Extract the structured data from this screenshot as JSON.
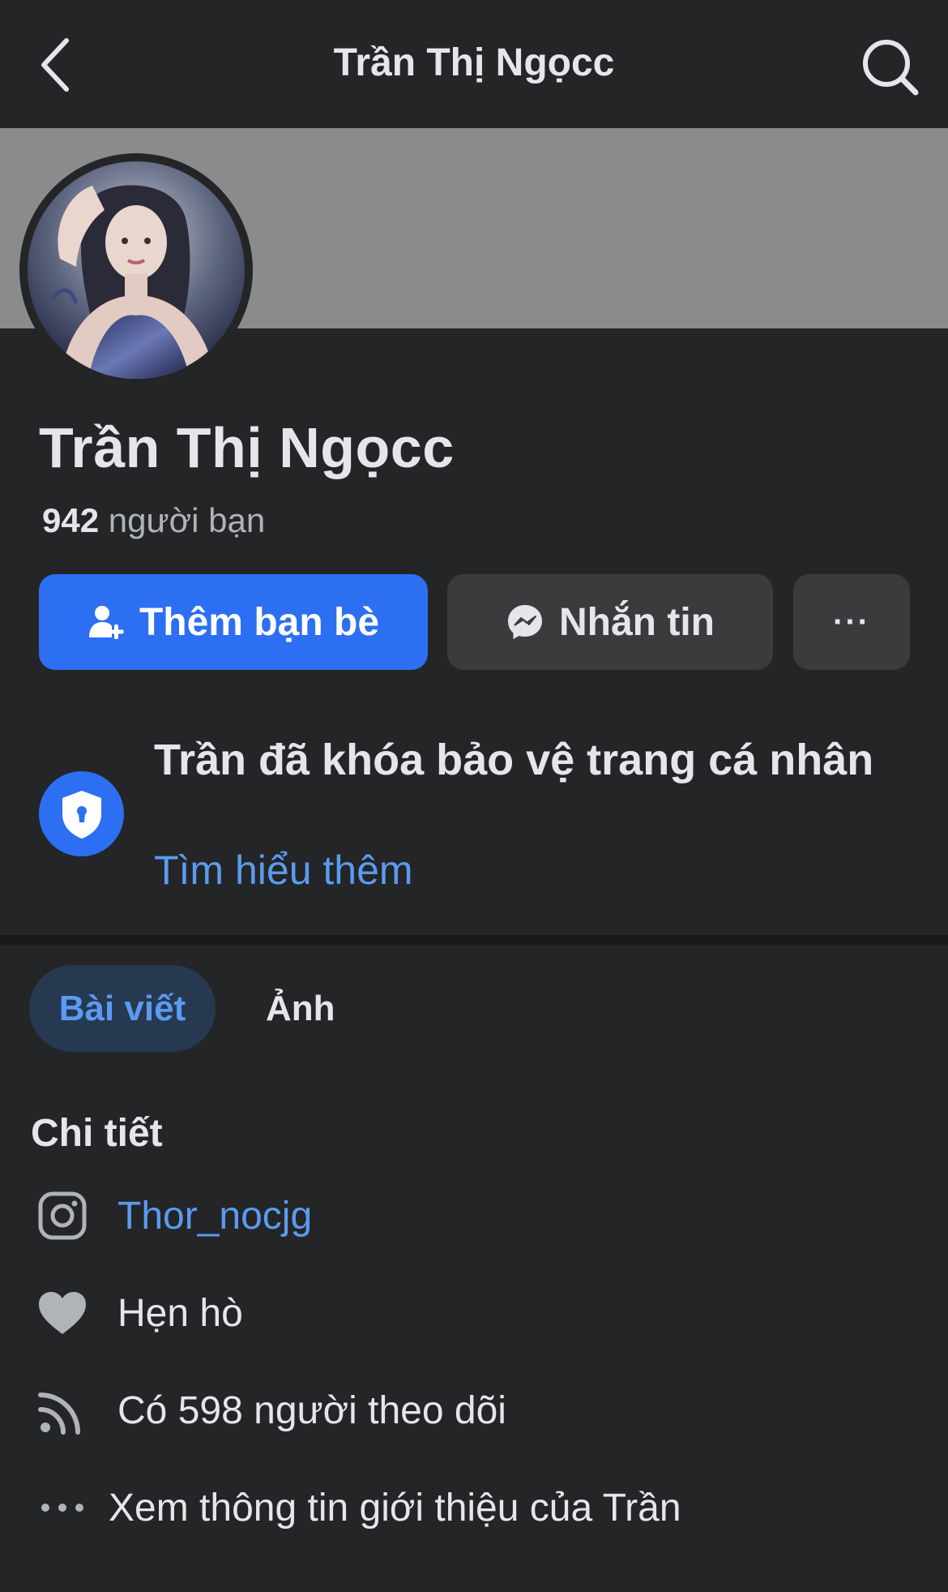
{
  "header": {
    "title": "Trần Thị Ngọcc",
    "back_icon": "chevron-left-icon",
    "search_icon": "search-icon"
  },
  "profile": {
    "name": "Trần Thị Ngọcc",
    "friends_count": "942",
    "friends_label": "người bạn"
  },
  "actions": {
    "add_friend_label": "Thêm bạn bè",
    "message_label": "Nhắn tin",
    "more_label": "···"
  },
  "lock_notice": {
    "title": "Trần đã khóa bảo vệ trang cá nhân",
    "link_label": "Tìm hiểu thêm"
  },
  "tabs": [
    {
      "label": "Bài viết",
      "active": true
    },
    {
      "label": "Ảnh",
      "active": false
    }
  ],
  "details": {
    "heading": "Chi tiết",
    "items": [
      {
        "icon": "instagram-icon",
        "text": "Thor_nocjg",
        "link": true
      },
      {
        "icon": "heart-icon",
        "text": "Hẹn hò",
        "link": false
      },
      {
        "icon": "rss-followers-icon",
        "text": "Có 598 người theo dõi",
        "link": false
      },
      {
        "icon": "more-dots-icon",
        "text": "Xem thông tin giới thiệu của Trần",
        "link": false
      }
    ]
  },
  "colors": {
    "background": "#242526",
    "accent": "#2d6ff2",
    "link": "#5a9bf0",
    "button_secondary": "#3a3b3c"
  }
}
